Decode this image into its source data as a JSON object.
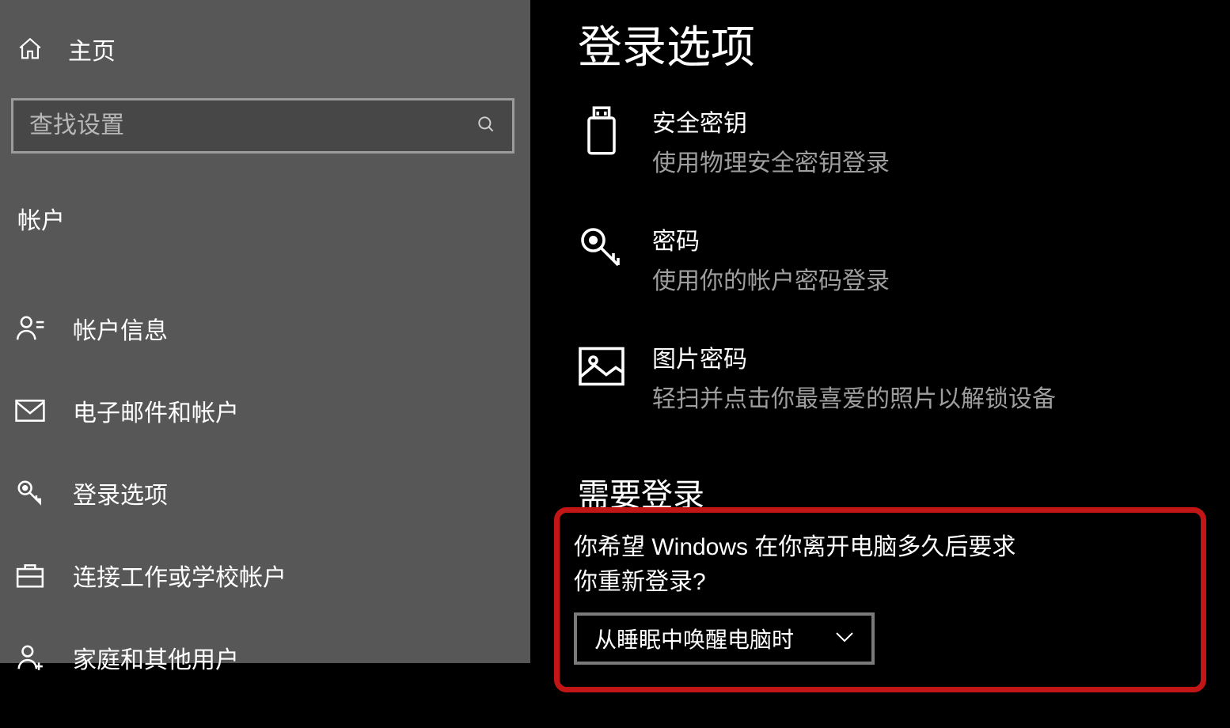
{
  "sidebar": {
    "home_label": "主页",
    "search_placeholder": "查找设置",
    "category_label": "帐户",
    "items": [
      {
        "label": "帐户信息",
        "icon": "person"
      },
      {
        "label": "电子邮件和帐户",
        "icon": "mail"
      },
      {
        "label": "登录选项",
        "icon": "key"
      },
      {
        "label": "连接工作或学校帐户",
        "icon": "briefcase"
      },
      {
        "label": "家庭和其他用户",
        "icon": "person-add"
      }
    ]
  },
  "main": {
    "title": "登录选项",
    "options": [
      {
        "title": "安全密钥",
        "desc": "使用物理安全密钥登录",
        "icon": "usb"
      },
      {
        "title": "密码",
        "desc": "使用你的帐户密码登录",
        "icon": "key-large"
      },
      {
        "title": "图片密码",
        "desc": "轻扫并点击你最喜爱的照片以解锁设备",
        "icon": "picture"
      }
    ],
    "require_signin_heading": "需要登录",
    "require_signin_question": "你希望 Windows 在你离开电脑多久后要求你重新登录?",
    "dropdown_value": "从睡眠中唤醒电脑时"
  }
}
